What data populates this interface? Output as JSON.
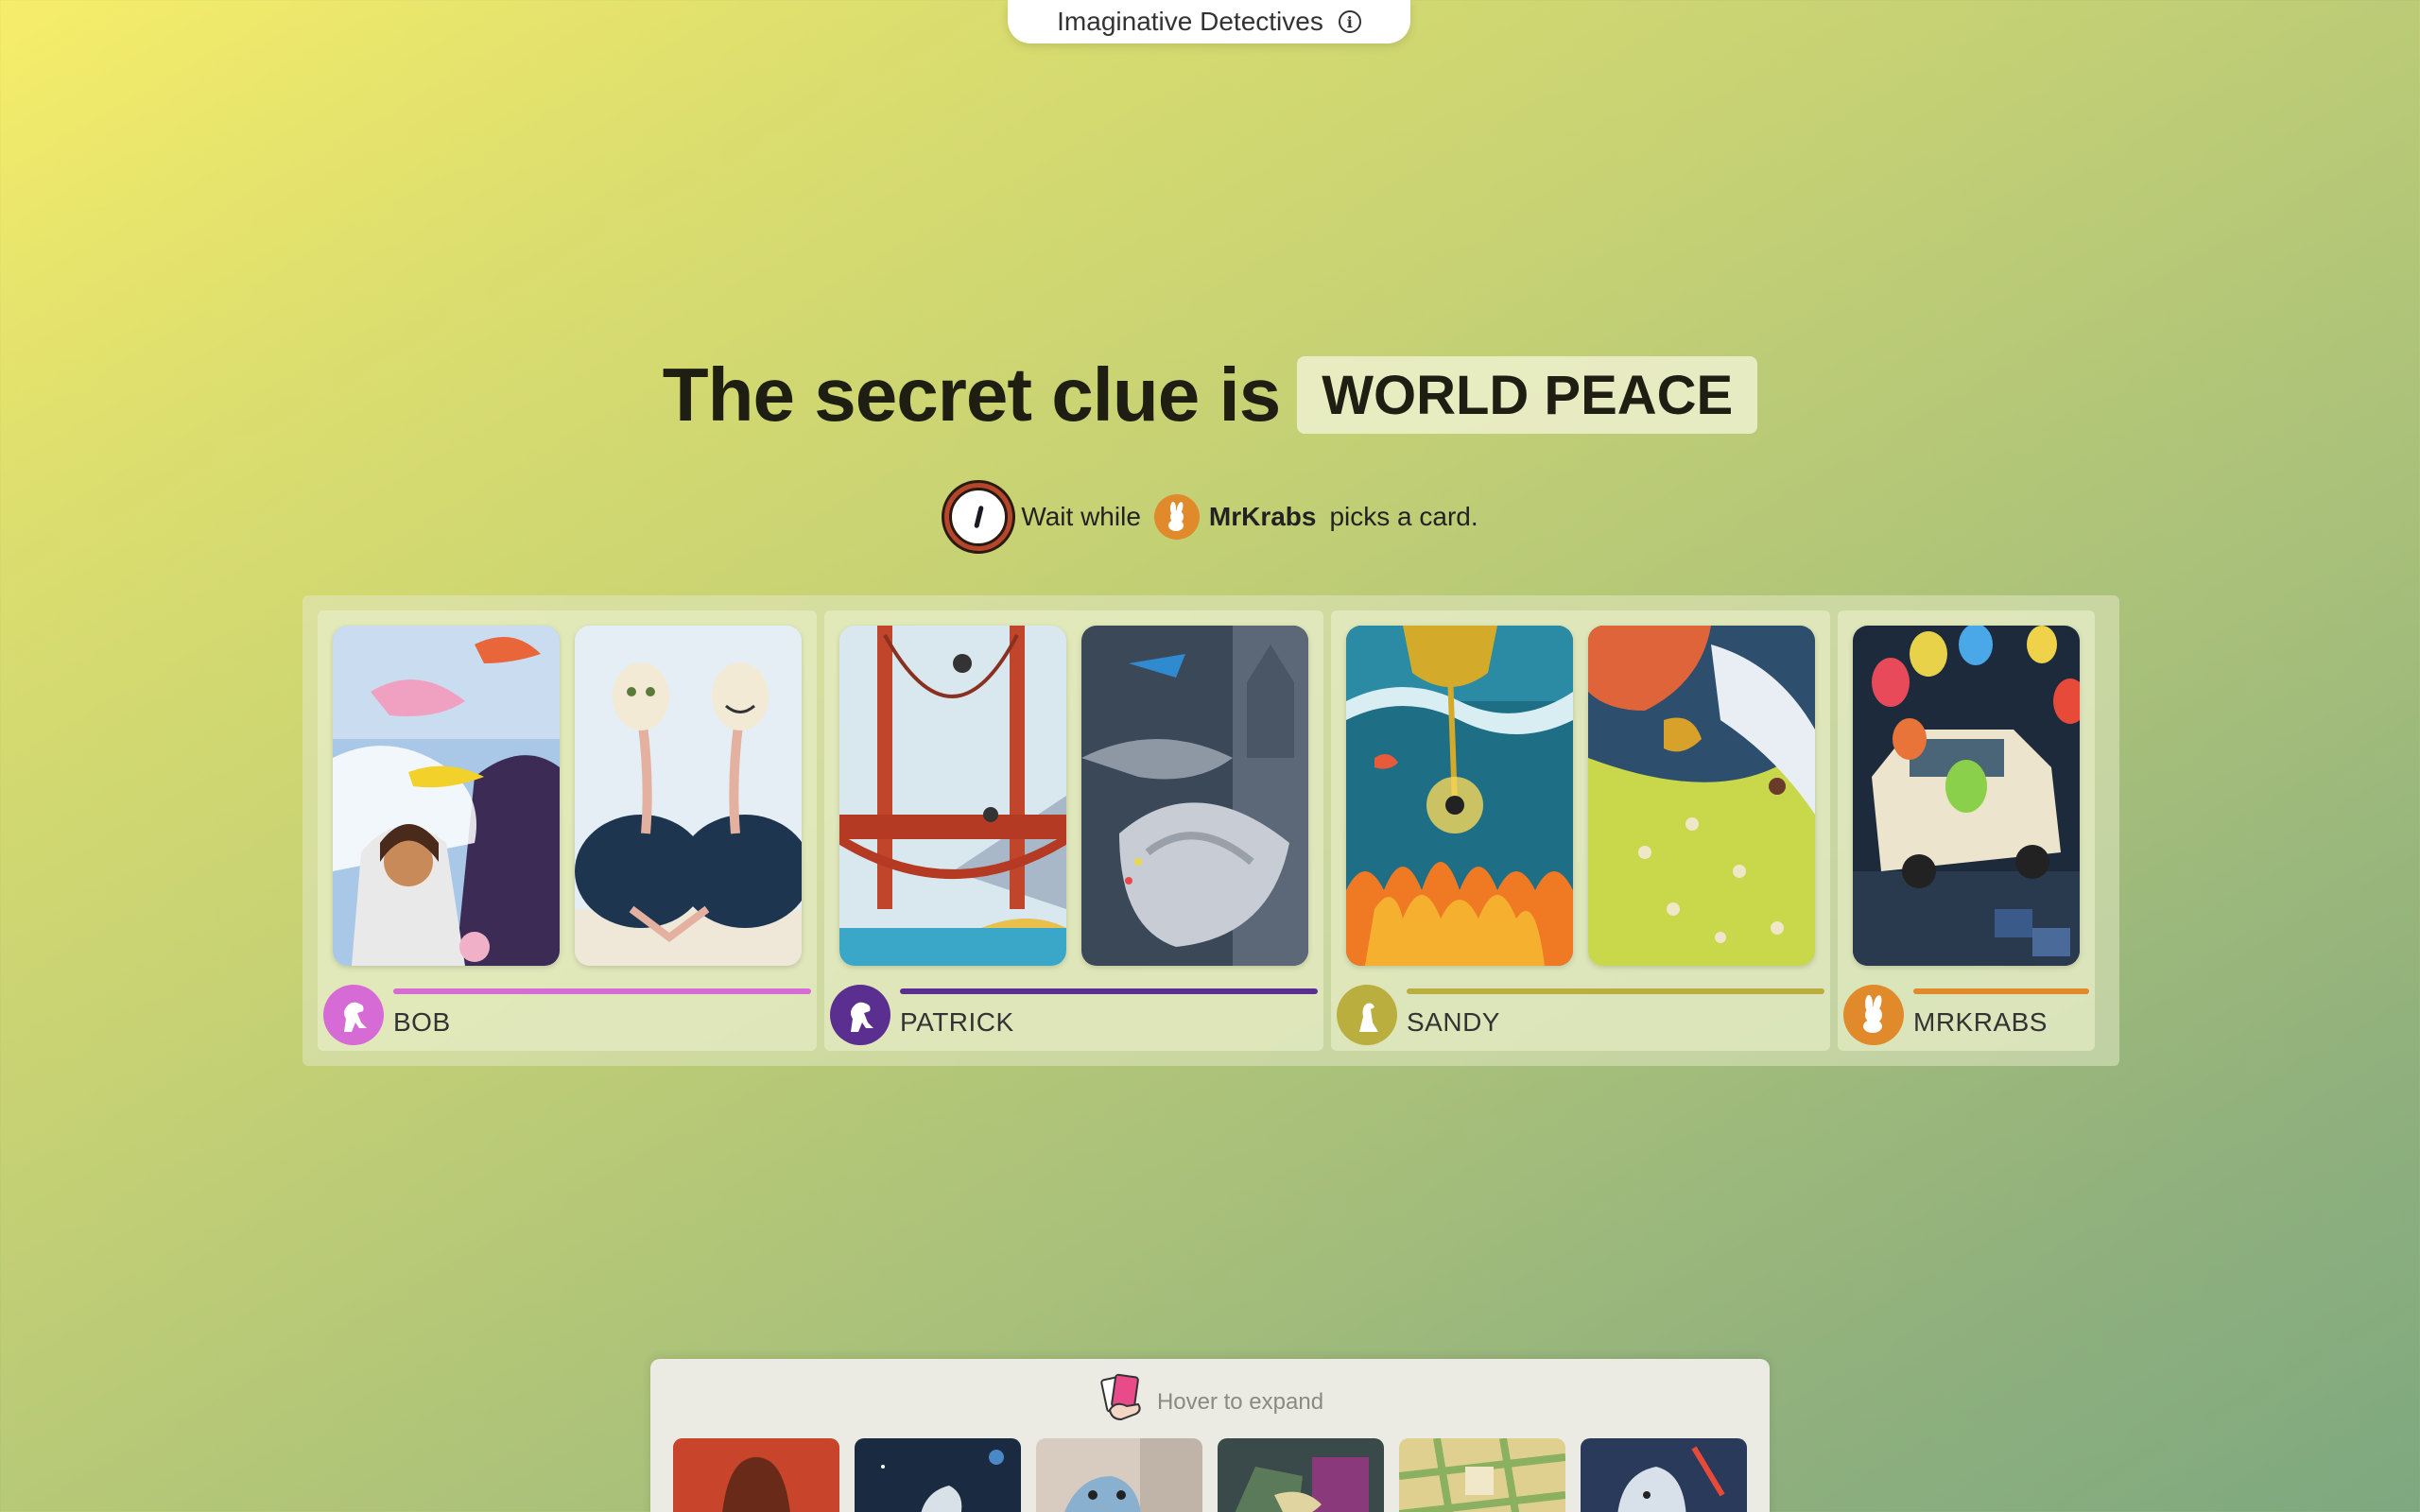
{
  "game": {
    "title": "Imaginative Detectives",
    "info_icon": "info-icon"
  },
  "headline": {
    "prefix": "The secret clue is",
    "clue": "WORLD PEACE"
  },
  "status": {
    "icon": "clock-icon",
    "wait_text": "Wait while",
    "player_name": "MrKrabs",
    "action_text": "picks a card."
  },
  "players": [
    {
      "name": "BOB",
      "color": "#d66bd6",
      "icon": "dinosaur-icon",
      "cards": [
        "card-bob-1",
        "card-bob-2"
      ]
    },
    {
      "name": "PATRICK",
      "color": "#5b2f8f",
      "icon": "dinosaur-icon",
      "cards": [
        "card-patrick-1",
        "card-patrick-2"
      ]
    },
    {
      "name": "SANDY",
      "color": "#b9ae3e",
      "icon": "dinosaur-icon",
      "cards": [
        "card-sandy-1",
        "card-sandy-2"
      ]
    },
    {
      "name": "MRKRABS",
      "color": "#e08a2c",
      "icon": "rabbit-icon",
      "cards": [
        "card-mrkrabs-1"
      ]
    }
  ],
  "hand": {
    "hint": "Hover to expand",
    "icon": "hand-cards-icon",
    "card_count": 6
  }
}
